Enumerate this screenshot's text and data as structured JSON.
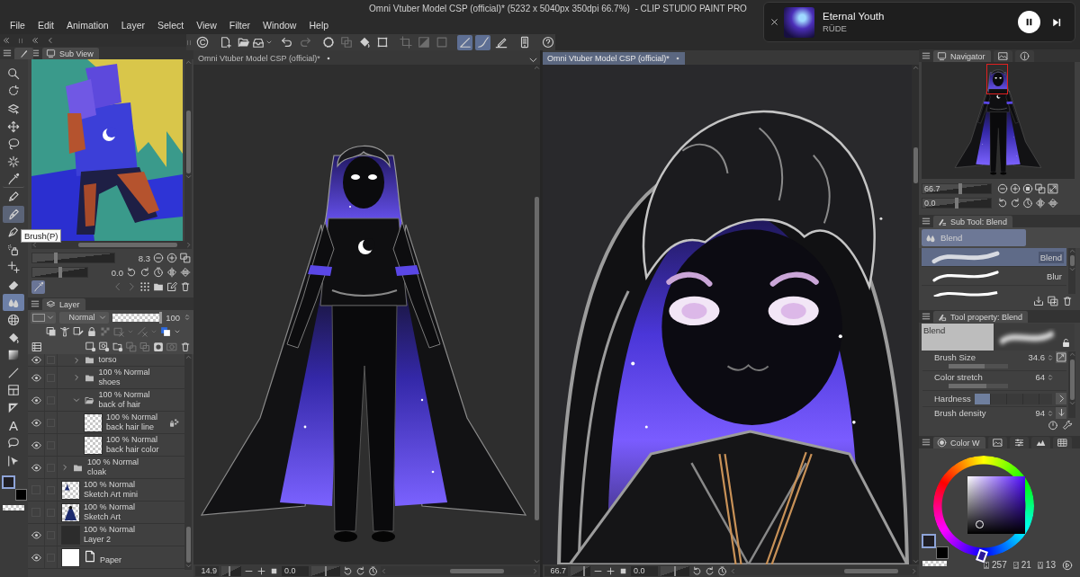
{
  "window": {
    "title": "Omni Vtuber Model CSP (official)* (5232 x 5040px 350dpi 66.7%)  - CLIP STUDIO PAINT PRO"
  },
  "menu": [
    "File",
    "Edit",
    "Animation",
    "Layer",
    "Select",
    "View",
    "Filter",
    "Window",
    "Help"
  ],
  "media_player": {
    "title": "Eternal Youth",
    "artist": "RÜDE",
    "playing": true
  },
  "command_bar": [
    {
      "kind": "logo",
      "on": false,
      "disabled": false
    },
    {
      "kind": "new",
      "on": false,
      "disabled": false
    },
    {
      "kind": "open",
      "on": false,
      "disabled": false
    },
    {
      "kind": "save",
      "on": false,
      "disabled": false
    },
    {
      "kind": "undo",
      "on": false,
      "disabled": false
    },
    {
      "kind": "redo",
      "on": false,
      "disabled": true
    },
    {
      "kind": "clear",
      "on": false,
      "disabled": false
    },
    {
      "kind": "copy",
      "on": false,
      "disabled": true
    },
    {
      "kind": "fill",
      "on": false,
      "disabled": false
    },
    {
      "kind": "transform",
      "on": false,
      "disabled": false
    },
    {
      "kind": "crop",
      "on": false,
      "disabled": true
    },
    {
      "kind": "invert",
      "on": false,
      "disabled": true
    },
    {
      "kind": "deselect",
      "on": false,
      "disabled": true
    },
    {
      "kind": "angle",
      "on": true,
      "disabled": false
    },
    {
      "kind": "curve",
      "on": true,
      "disabled": false
    },
    {
      "kind": "ruler-pen",
      "on": false,
      "disabled": false
    },
    {
      "kind": "tablet",
      "on": false,
      "disabled": false
    },
    {
      "kind": "help",
      "on": false,
      "disabled": false
    }
  ],
  "tools": [
    {
      "kind": "zoom",
      "selected": false,
      "hovered": false
    },
    {
      "kind": "rotate",
      "selected": false,
      "hovered": false
    },
    {
      "kind": "layer-select",
      "selected": false,
      "hovered": false
    },
    {
      "kind": "move",
      "selected": false,
      "hovered": false
    },
    {
      "kind": "lasso",
      "selected": false,
      "hovered": false
    },
    {
      "kind": "auto-select",
      "selected": false,
      "hovered": false
    },
    {
      "kind": "eyedropper",
      "selected": false,
      "hovered": false
    },
    {
      "kind": "pen",
      "selected": false,
      "hovered": false
    },
    {
      "kind": "brush",
      "selected": false,
      "hovered": true
    },
    {
      "kind": "nib",
      "selected": false,
      "hovered": false
    },
    {
      "kind": "airbrush",
      "selected": false,
      "hovered": false
    },
    {
      "kind": "decoration",
      "selected": false,
      "hovered": false
    },
    {
      "kind": "eraser",
      "selected": false,
      "hovered": false
    },
    {
      "kind": "blend",
      "selected": true,
      "hovered": false
    },
    {
      "kind": "mesh",
      "selected": false,
      "hovered": false
    },
    {
      "kind": "fill",
      "selected": false,
      "hovered": false
    },
    {
      "kind": "gradient",
      "selected": false,
      "hovered": false
    },
    {
      "kind": "line",
      "selected": false,
      "hovered": false
    },
    {
      "kind": "frame",
      "selected": false,
      "hovered": false
    },
    {
      "kind": "ruler",
      "selected": false,
      "hovered": false
    },
    {
      "kind": "text",
      "label": "A",
      "selected": false,
      "hovered": false
    },
    {
      "kind": "balloon",
      "selected": false,
      "hovered": false
    },
    {
      "kind": "correct",
      "selected": false,
      "hovered": false
    }
  ],
  "tool_colors": [
    {
      "color": "#1f1e24",
      "selected": true
    },
    {
      "color": "#000000",
      "selected": false
    }
  ],
  "tooltip": "Brush(P)",
  "sub_view": {
    "tab": "Sub View",
    "zoom": {
      "value": "8.3",
      "level": 0.29
    },
    "rotation": {
      "value": "0.0",
      "level": 0.5
    },
    "eyedropper_on": true
  },
  "layer_panel": {
    "tab": "Layer",
    "blend_mode": "Normal",
    "opacity": {
      "value": "100",
      "level": 1
    },
    "layers": [
      {
        "children": [
          {
            "kind": "folder",
            "name": "torso",
            "visible": true,
            "marked": false,
            "expanded": false
          },
          {
            "kind": "folder",
            "status": "100 % Normal",
            "name": "shoes",
            "visible": true,
            "marked": false,
            "expanded": false
          },
          {
            "kind": "folder",
            "status": "100 % Normal",
            "name": "back of hair",
            "visible": true,
            "marked": false,
            "expanded": true,
            "children": [
              {
                "kind": "transparent-layer",
                "status": "100 % Normal",
                "name": "back hair line",
                "visible": true,
                "marked": false,
                "reference": true
              },
              {
                "kind": "transparent-layer",
                "status": "100 % Normal",
                "name": "back hair color",
                "visible": true,
                "marked": false,
                "reference": false
              }
            ]
          }
        ]
      },
      {
        "kind": "folder",
        "status": "100 % Normal",
        "name": "cloak",
        "visible": true,
        "marked": false,
        "expanded": false
      },
      {
        "kind": "sketch-layer-small",
        "status": "100 % Normal",
        "name": "Sketch Art mini",
        "visible": false,
        "marked": false,
        "reference": false
      },
      {
        "kind": "sketch-layer",
        "status": "100 % Normal",
        "name": "Sketch Art",
        "visible": false,
        "marked": false,
        "reference": false
      },
      {
        "kind": "dark-layer",
        "status": "100 % Normal",
        "name": "Layer 2",
        "visible": true,
        "marked": false,
        "reference": false
      },
      {
        "kind": "paper",
        "name": "Paper",
        "visible": true,
        "marked": false
      }
    ]
  },
  "canvases": [
    {
      "kind": "full-figure",
      "tab": "Omni Vtuber Model CSP (official)*",
      "selected": false,
      "zoom": {
        "value": "14.9",
        "level": 0.4
      },
      "rotation": {
        "value": "0.0",
        "level": 0.5
      }
    },
    {
      "kind": "closeup",
      "tab": "Omni Vtuber Model CSP (official)*",
      "selected": true,
      "zoom": {
        "value": "66.7",
        "level": 0.7
      },
      "rotation": {
        "value": "0.0",
        "level": 0.5
      }
    }
  ],
  "navigator": {
    "tabs": [
      {
        "kind": "navigator",
        "label": "Navigator",
        "selected": true
      },
      {
        "kind": "image",
        "selected": false
      },
      {
        "kind": "info",
        "selected": false
      }
    ],
    "zoom": {
      "value": "66.7",
      "level": 0.55
    },
    "rotation": {
      "value": "0.0",
      "level": 0.5
    }
  },
  "sub_tool": {
    "tab": "Sub Tool: Blend",
    "group": {
      "label": "Blend",
      "selected": true
    },
    "brushes": [
      {
        "name": "Blend",
        "selected": true
      },
      {
        "name": "Blur",
        "selected": false
      },
      {
        "selected": false
      }
    ]
  },
  "tool_property": {
    "tab": "Tool property: Blend",
    "preview_label": "Blend",
    "properties": [
      {
        "kind": "slider-pressure",
        "label": "Brush Size",
        "value": "34.6",
        "level": 0.6
      },
      {
        "kind": "slider",
        "label": "Color stretch",
        "value": "64",
        "level": 0.64
      },
      {
        "kind": "segments",
        "label": "Hardness",
        "level": 0.2
      },
      {
        "kind": "slider-arrow",
        "label": "Brush density",
        "value": "94"
      }
    ]
  },
  "color_wheel": {
    "tabs": [
      {
        "kind": "color-wheel",
        "label": "Color W",
        "selected": true
      },
      {
        "kind": "image",
        "selected": false
      },
      {
        "kind": "sliders",
        "selected": false
      },
      {
        "kind": "mountains",
        "selected": false
      },
      {
        "kind": "palette",
        "selected": false
      }
    ],
    "colors": [
      {
        "color": "#1f1e24",
        "selected": true
      },
      {
        "color": "#000000",
        "selected": false
      }
    ],
    "hsv": [
      {
        "label": "H",
        "value": "257"
      },
      {
        "label": "S",
        "value": "21"
      },
      {
        "label": "V",
        "value": "13"
      }
    ]
  }
}
